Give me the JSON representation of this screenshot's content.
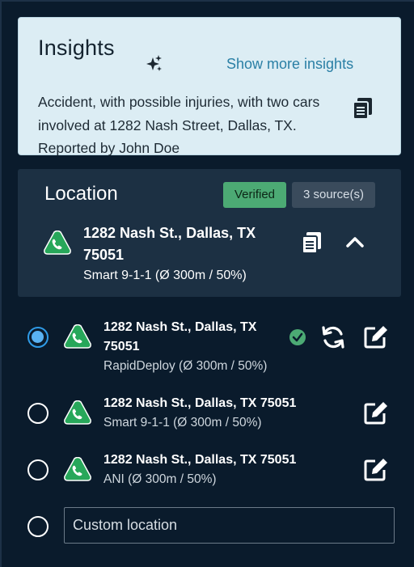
{
  "insights": {
    "title": "Insights",
    "show_more_label": "Show more insights",
    "text": "Accident, with possible injuries, with two cars involved at 1282 Nash Street, Dallas, TX. Reported by John Doe",
    "icons": [
      "sparkle-icon",
      "copy-icon"
    ]
  },
  "location": {
    "title": "Location",
    "verified_label": "Verified",
    "sources_label": "3 source(s)",
    "address": "1282 Nash St., Dallas, TX 75051",
    "source_detail": "Smart 9-1-1 (Ø 300m / 50%)",
    "icons": [
      "phone-location-icon",
      "copy-icon",
      "chevron-up-icon"
    ]
  },
  "options": [
    {
      "address": "1282 Nash St., Dallas, TX 75051",
      "source_detail": "RapidDeploy (Ø 300m / 50%)",
      "selected": true,
      "icons": [
        "check-circle-icon",
        "refresh-icon",
        "edit-icon"
      ]
    },
    {
      "address": "1282 Nash St., Dallas, TX 75051",
      "source_detail": "Smart 9-1-1 (Ø 300m / 50%)",
      "selected": false,
      "icons": [
        "edit-icon"
      ]
    },
    {
      "address": "1282 Nash St., Dallas, TX 75051",
      "source_detail": "ANI (Ø 300m / 50%)",
      "selected": false,
      "icons": [
        "edit-icon"
      ]
    }
  ],
  "custom_location": {
    "placeholder": "Custom location",
    "value": ""
  },
  "colors": {
    "background": "#0a1b2c",
    "insights_bg": "#dcedf4",
    "card_bg": "#1c3043",
    "verified": "#4caa74",
    "accent_link": "#2a7fa5",
    "radio_selected": "#2f9be7",
    "phone_icon": "#27a75a"
  }
}
